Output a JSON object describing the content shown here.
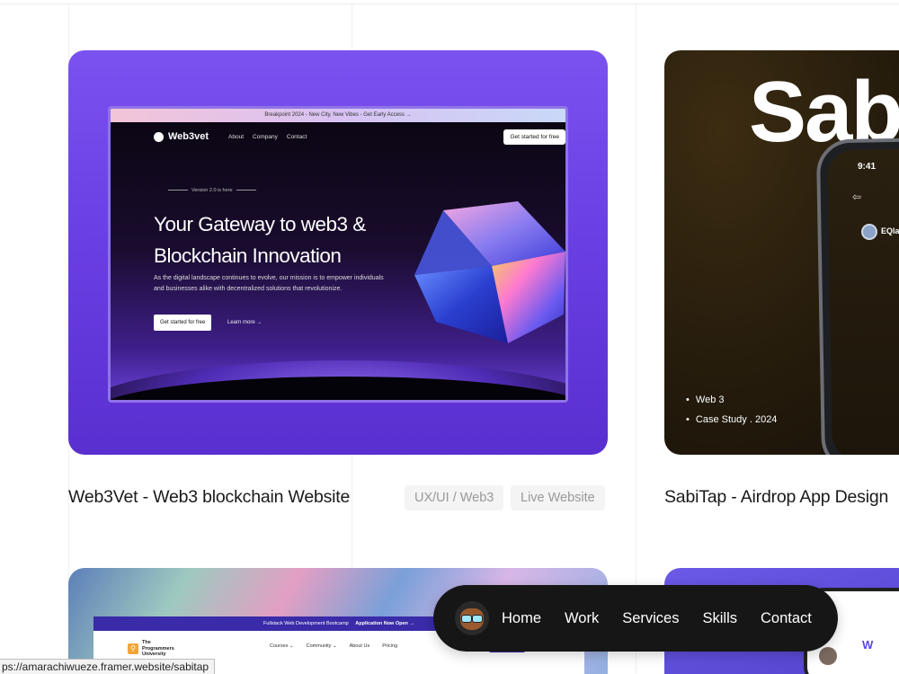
{
  "projects": [
    {
      "title": "Web3Vet - Web3 blockchain Website",
      "tags": [
        "UX/UI / Web3",
        "Live Website"
      ],
      "mockup": {
        "banner": "Breakpoint 2024 - New City, New Vibes - Get Early Access →",
        "logo": "Web3vet",
        "nav_links": [
          "About",
          "Company",
          "Contact"
        ],
        "cta": "Get started for free",
        "version": "Version 2.0 is here",
        "headline": "Your Gateway to web3 & Blockchain Innovation",
        "description": "As the digital landscape continues to evolve, our mission is to empower individuals and businesses alike with decentralized solutions that revolutionize.",
        "primary_button": "Get started for free",
        "secondary_link": "Learn more →"
      }
    },
    {
      "title": "SabiTap - Airdrop App Design",
      "cover_text": "Sab",
      "phone_time": "9:41",
      "phone_user": "EQlad",
      "bullets": [
        "Web 3",
        "Case Study . 2024"
      ]
    },
    {
      "mockup": {
        "banner_text": "Fullstack Web Development Bootcamp",
        "banner_cta": "Application Now Open →",
        "logo": "The Programmers University",
        "nav_links": [
          "Courses ⌄",
          "Community ⌄",
          "About Us",
          "Pricing"
        ]
      }
    },
    {
      "letter": "W"
    }
  ],
  "navbar": {
    "items": [
      "Home",
      "Work",
      "Services",
      "Skills",
      "Contact"
    ]
  },
  "status_bar": {
    "url": "ps://amarachiwueze.framer.website/sabitap"
  }
}
